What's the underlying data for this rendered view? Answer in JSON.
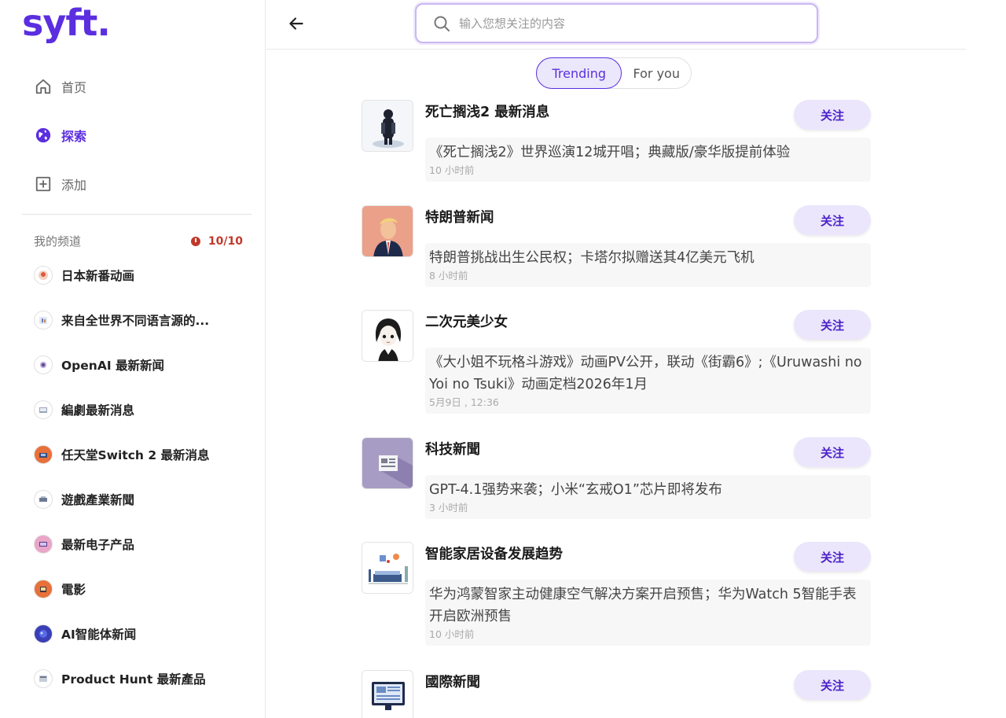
{
  "brand": {
    "logo_text": "syft.",
    "accent": "#5b2ee0"
  },
  "nav": {
    "items": [
      {
        "label": "首页",
        "icon": "home-icon"
      },
      {
        "label": "探索",
        "icon": "globe-icon",
        "active": true
      },
      {
        "label": "添加",
        "icon": "plus-square-icon"
      }
    ]
  },
  "channels": {
    "title": "我的频道",
    "count": "10/10",
    "items": [
      {
        "name": "日本新番动画"
      },
      {
        "name": "来自全世界不同语言源的..."
      },
      {
        "name": "OpenAI 最新新闻"
      },
      {
        "name": "編劇最新消息"
      },
      {
        "name": "任天堂Switch 2 最新消息"
      },
      {
        "name": "遊戲產業新聞"
      },
      {
        "name": "最新电子产品"
      },
      {
        "name": "電影"
      },
      {
        "name": "AI智能体新闻"
      },
      {
        "name": "Product Hunt 最新產品"
      }
    ]
  },
  "search": {
    "placeholder": "输入您想关注的内容"
  },
  "tabs": [
    {
      "label": "Trending",
      "active": true
    },
    {
      "label": "For you"
    }
  ],
  "feed": {
    "follow_label": "关注",
    "items": [
      {
        "title": "死亡搁浅2 最新消息",
        "news": "《死亡搁浅2》世界巡演12城开唱；典藏版/豪华版提前体验",
        "time": "10 小时前"
      },
      {
        "title": "特朗普新闻",
        "news": "特朗普挑战出生公民权；卡塔尔拟赠送其4亿美元飞机",
        "time": "8 小时前"
      },
      {
        "title": "二次元美少女",
        "news": "《大小姐不玩格斗游戏》动画PV公开，联动《街霸6》;《Uruwashi no Yoi no Tsuki》动画定档2026年1月",
        "time": "5月9日 , 12:36"
      },
      {
        "title": "科技新聞",
        "news": "GPT-4.1强势来袭；小米“玄戒O1”芯片即将发布",
        "time": "3 小时前"
      },
      {
        "title": "智能家居设备发展趋势",
        "news": "华为鸿蒙智家主动健康空气解决方案开启预售；华为Watch 5智能手表开启欧洲预售",
        "time": "10 小时前"
      },
      {
        "title": "國際新聞",
        "news": "",
        "time": ""
      }
    ]
  }
}
